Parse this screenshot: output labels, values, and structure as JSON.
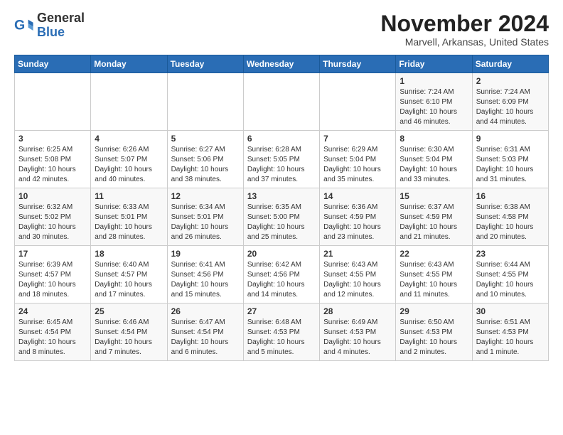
{
  "logo": {
    "general": "General",
    "blue": "Blue"
  },
  "header": {
    "month": "November 2024",
    "location": "Marvell, Arkansas, United States"
  },
  "weekdays": [
    "Sunday",
    "Monday",
    "Tuesday",
    "Wednesday",
    "Thursday",
    "Friday",
    "Saturday"
  ],
  "weeks": [
    [
      {
        "day": "",
        "info": ""
      },
      {
        "day": "",
        "info": ""
      },
      {
        "day": "",
        "info": ""
      },
      {
        "day": "",
        "info": ""
      },
      {
        "day": "",
        "info": ""
      },
      {
        "day": "1",
        "info": "Sunrise: 7:24 AM\nSunset: 6:10 PM\nDaylight: 10 hours\nand 46 minutes."
      },
      {
        "day": "2",
        "info": "Sunrise: 7:24 AM\nSunset: 6:09 PM\nDaylight: 10 hours\nand 44 minutes."
      }
    ],
    [
      {
        "day": "3",
        "info": "Sunrise: 6:25 AM\nSunset: 5:08 PM\nDaylight: 10 hours\nand 42 minutes."
      },
      {
        "day": "4",
        "info": "Sunrise: 6:26 AM\nSunset: 5:07 PM\nDaylight: 10 hours\nand 40 minutes."
      },
      {
        "day": "5",
        "info": "Sunrise: 6:27 AM\nSunset: 5:06 PM\nDaylight: 10 hours\nand 38 minutes."
      },
      {
        "day": "6",
        "info": "Sunrise: 6:28 AM\nSunset: 5:05 PM\nDaylight: 10 hours\nand 37 minutes."
      },
      {
        "day": "7",
        "info": "Sunrise: 6:29 AM\nSunset: 5:04 PM\nDaylight: 10 hours\nand 35 minutes."
      },
      {
        "day": "8",
        "info": "Sunrise: 6:30 AM\nSunset: 5:04 PM\nDaylight: 10 hours\nand 33 minutes."
      },
      {
        "day": "9",
        "info": "Sunrise: 6:31 AM\nSunset: 5:03 PM\nDaylight: 10 hours\nand 31 minutes."
      }
    ],
    [
      {
        "day": "10",
        "info": "Sunrise: 6:32 AM\nSunset: 5:02 PM\nDaylight: 10 hours\nand 30 minutes."
      },
      {
        "day": "11",
        "info": "Sunrise: 6:33 AM\nSunset: 5:01 PM\nDaylight: 10 hours\nand 28 minutes."
      },
      {
        "day": "12",
        "info": "Sunrise: 6:34 AM\nSunset: 5:01 PM\nDaylight: 10 hours\nand 26 minutes."
      },
      {
        "day": "13",
        "info": "Sunrise: 6:35 AM\nSunset: 5:00 PM\nDaylight: 10 hours\nand 25 minutes."
      },
      {
        "day": "14",
        "info": "Sunrise: 6:36 AM\nSunset: 4:59 PM\nDaylight: 10 hours\nand 23 minutes."
      },
      {
        "day": "15",
        "info": "Sunrise: 6:37 AM\nSunset: 4:59 PM\nDaylight: 10 hours\nand 21 minutes."
      },
      {
        "day": "16",
        "info": "Sunrise: 6:38 AM\nSunset: 4:58 PM\nDaylight: 10 hours\nand 20 minutes."
      }
    ],
    [
      {
        "day": "17",
        "info": "Sunrise: 6:39 AM\nSunset: 4:57 PM\nDaylight: 10 hours\nand 18 minutes."
      },
      {
        "day": "18",
        "info": "Sunrise: 6:40 AM\nSunset: 4:57 PM\nDaylight: 10 hours\nand 17 minutes."
      },
      {
        "day": "19",
        "info": "Sunrise: 6:41 AM\nSunset: 4:56 PM\nDaylight: 10 hours\nand 15 minutes."
      },
      {
        "day": "20",
        "info": "Sunrise: 6:42 AM\nSunset: 4:56 PM\nDaylight: 10 hours\nand 14 minutes."
      },
      {
        "day": "21",
        "info": "Sunrise: 6:43 AM\nSunset: 4:55 PM\nDaylight: 10 hours\nand 12 minutes."
      },
      {
        "day": "22",
        "info": "Sunrise: 6:43 AM\nSunset: 4:55 PM\nDaylight: 10 hours\nand 11 minutes."
      },
      {
        "day": "23",
        "info": "Sunrise: 6:44 AM\nSunset: 4:55 PM\nDaylight: 10 hours\nand 10 minutes."
      }
    ],
    [
      {
        "day": "24",
        "info": "Sunrise: 6:45 AM\nSunset: 4:54 PM\nDaylight: 10 hours\nand 8 minutes."
      },
      {
        "day": "25",
        "info": "Sunrise: 6:46 AM\nSunset: 4:54 PM\nDaylight: 10 hours\nand 7 minutes."
      },
      {
        "day": "26",
        "info": "Sunrise: 6:47 AM\nSunset: 4:54 PM\nDaylight: 10 hours\nand 6 minutes."
      },
      {
        "day": "27",
        "info": "Sunrise: 6:48 AM\nSunset: 4:53 PM\nDaylight: 10 hours\nand 5 minutes."
      },
      {
        "day": "28",
        "info": "Sunrise: 6:49 AM\nSunset: 4:53 PM\nDaylight: 10 hours\nand 4 minutes."
      },
      {
        "day": "29",
        "info": "Sunrise: 6:50 AM\nSunset: 4:53 PM\nDaylight: 10 hours\nand 2 minutes."
      },
      {
        "day": "30",
        "info": "Sunrise: 6:51 AM\nSunset: 4:53 PM\nDaylight: 10 hours\nand 1 minute."
      }
    ]
  ]
}
